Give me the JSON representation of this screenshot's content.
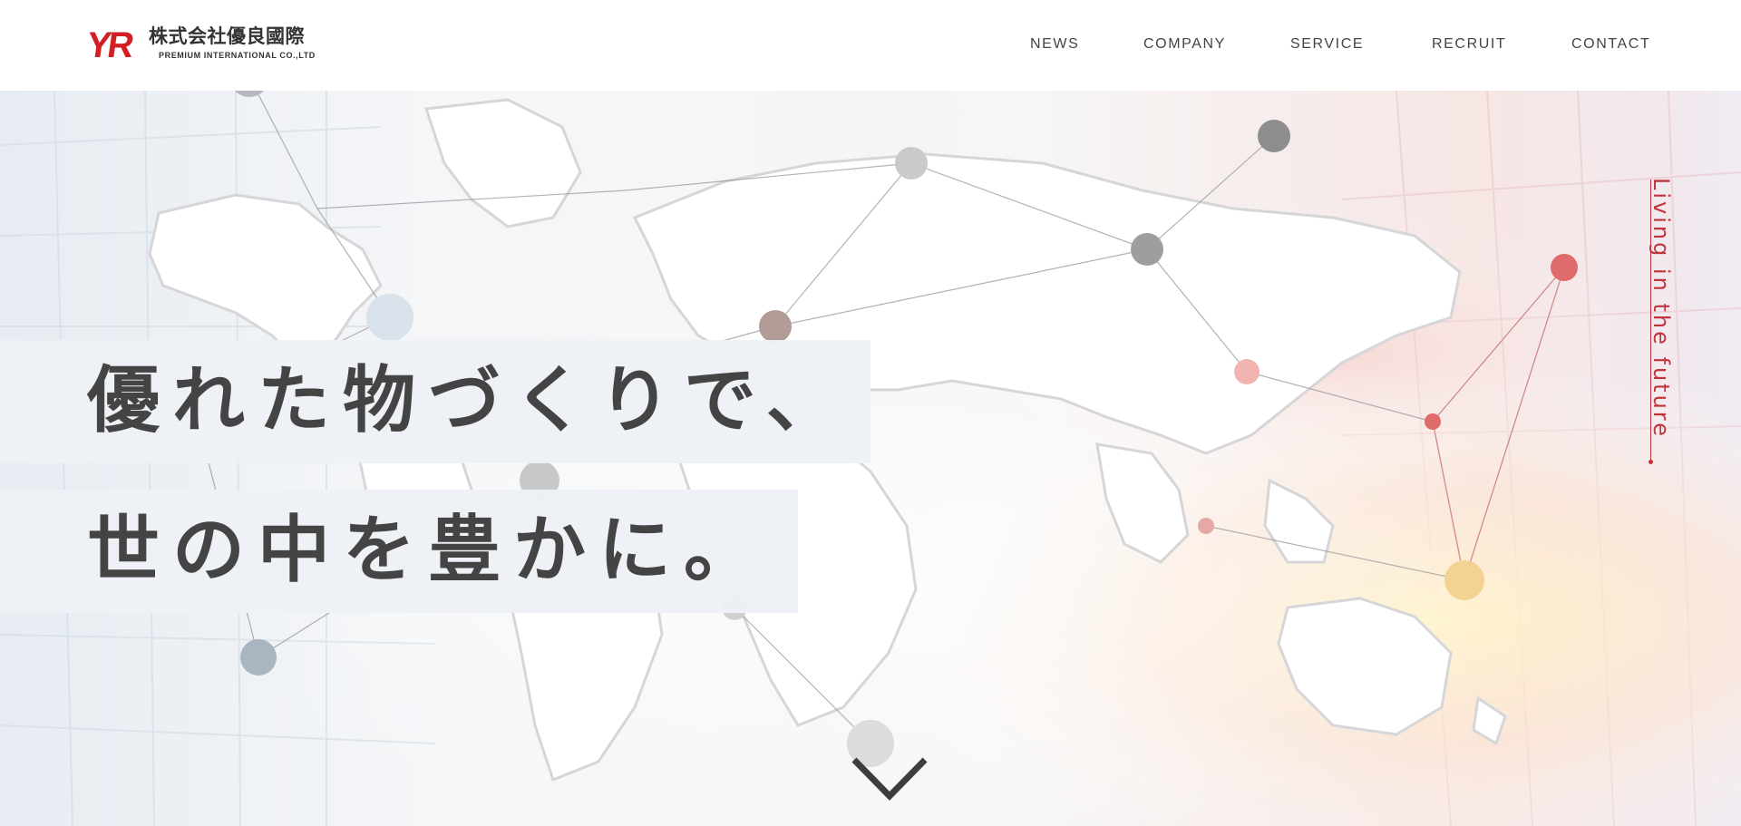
{
  "header": {
    "logo_mark": "YR",
    "company_name": "株式会社優良國際",
    "company_sub": "PREMIUM INTERNATIONAL CO.,LTD"
  },
  "nav": [
    {
      "label": "NEWS"
    },
    {
      "label": "COMPANY"
    },
    {
      "label": "SERVICE"
    },
    {
      "label": "RECRUIT"
    },
    {
      "label": "CONTACT"
    }
  ],
  "hero": {
    "headline_line1": "優れた物づくりで、",
    "headline_line2": "世の中を豊かに。",
    "tagline": "Living in the future",
    "scroll_icon": "chevron-down-icon"
  },
  "colors": {
    "brand_red": "#d21e25",
    "text_dark": "#444444",
    "accent_red": "#c0343b"
  }
}
